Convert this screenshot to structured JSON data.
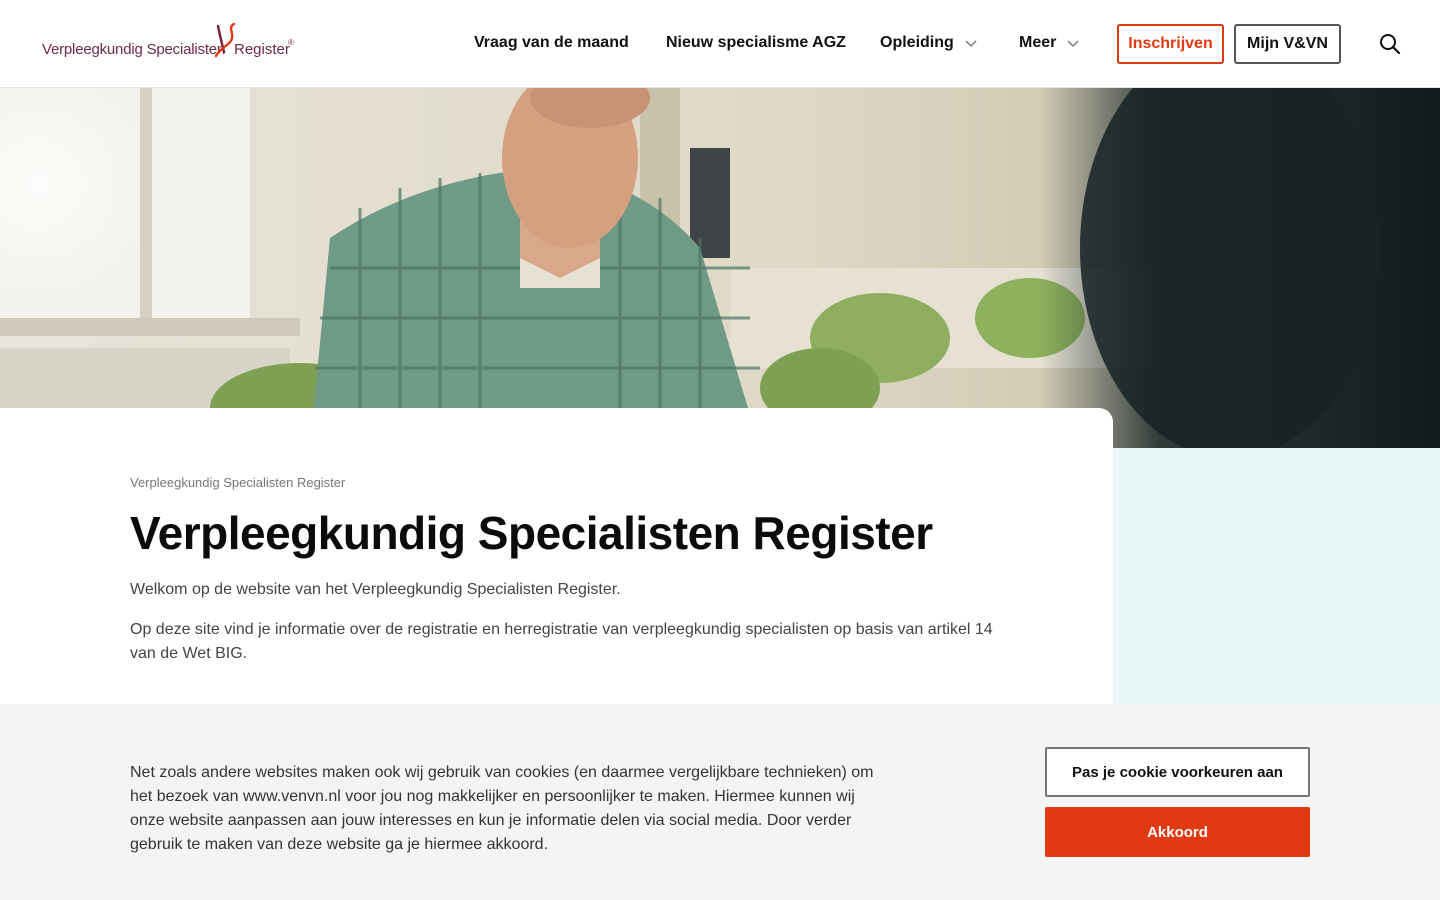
{
  "header": {
    "logo_text": "Verpleegkundig Specialisten",
    "logo_text_b": "Register",
    "logo_reg": "®",
    "nav": [
      {
        "label": "Vraag van de maand"
      },
      {
        "label": "Nieuw specialisme AGZ"
      },
      {
        "label": "Opleiding"
      },
      {
        "label": "Meer"
      }
    ],
    "inschrijven_label": "Inschrijven",
    "mijn_label": "Mijn V&VN"
  },
  "content": {
    "breadcrumb": "Verpleegkundig Specialisten Register",
    "title": "Verpleegkundig Specialisten Register",
    "paragraph1": "Welkom op de website van het Verpleegkundig Specialisten Register.",
    "paragraph2": "Op deze site vind je informatie over de registratie en herregistratie van verpleegkundig specialisten op basis van artikel 14 van de Wet BIG."
  },
  "cookie": {
    "text": "Net zoals andere websites maken ook wij gebruik van cookies (en daarmee vergelijkbare technieken) om het bezoek van www.venvn.nl voor jou nog makkelijker en persoonlijker te maken. Hiermee kunnen wij onze website aanpassen aan jouw interesses en kun je informatie delen via social media. Door verder gebruik te maken van deze website ga je hiermee akkoord.",
    "preferences_label": "Pas je cookie voorkeuren aan",
    "accept_label": "Akkoord"
  },
  "colors": {
    "accent": "#e03a12",
    "teal_panel": "#e8f6f5",
    "cookie_bg": "#f4f4f4"
  }
}
